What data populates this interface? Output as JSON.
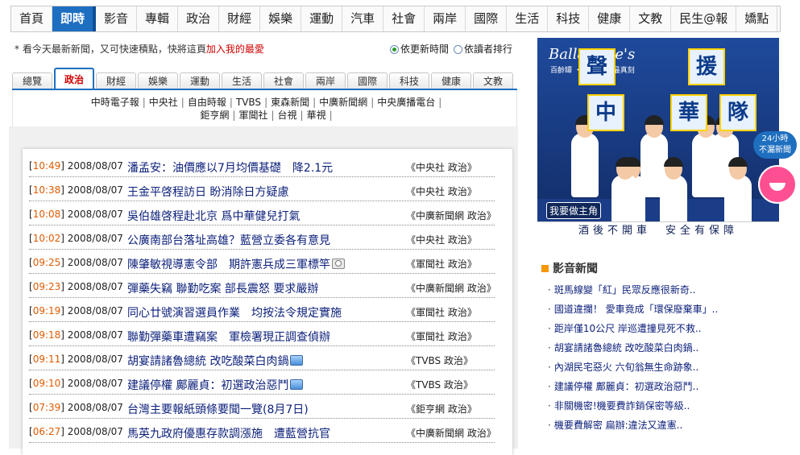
{
  "topnav": {
    "items": [
      {
        "label": "首頁"
      },
      {
        "label": "即時",
        "active": true
      },
      {
        "label": "影音"
      },
      {
        "label": "專輯"
      },
      {
        "label": "政治"
      },
      {
        "label": "財經"
      },
      {
        "label": "娛樂"
      },
      {
        "label": "運動"
      },
      {
        "label": "汽車"
      },
      {
        "label": "社會"
      },
      {
        "label": "兩岸"
      },
      {
        "label": "國際"
      },
      {
        "label": "生活"
      },
      {
        "label": "科技"
      },
      {
        "label": "健康"
      },
      {
        "label": "文教"
      },
      {
        "label": "民生@報"
      },
      {
        "label": "嬌點"
      }
    ]
  },
  "notice": {
    "prefix": "* 看今天最新新聞，又可快速積點，快將這頁",
    "link": "加入我的最愛"
  },
  "sort": {
    "option1": "依更新時間",
    "option2": "依讀者排行",
    "selected": "option1"
  },
  "cattabs": {
    "items": [
      {
        "label": "總覽"
      },
      {
        "label": "政治",
        "active": true
      },
      {
        "label": "財經"
      },
      {
        "label": "娛樂"
      },
      {
        "label": "運動"
      },
      {
        "label": "生活"
      },
      {
        "label": "社會"
      },
      {
        "label": "兩岸"
      },
      {
        "label": "國際"
      },
      {
        "label": "科技"
      },
      {
        "label": "健康"
      },
      {
        "label": "文教"
      }
    ]
  },
  "sources": {
    "line1": [
      "中時電子報",
      "中央社",
      "自由時報",
      "TVBS",
      "東森新聞",
      "中廣新聞網",
      "中央廣播電台"
    ],
    "line2": [
      "鉅亨網",
      "軍聞社",
      "台視",
      "華視"
    ]
  },
  "news": [
    {
      "time": "10:49",
      "date": "2008/08/07",
      "title": "潘孟安：油價應以7月均價基礎　降2.1元",
      "source": "《中央社 政治》",
      "icon": ""
    },
    {
      "time": "10:38",
      "date": "2008/08/07",
      "title": "王金平啓程訪日 盼消除日方疑慮",
      "source": "《中央社 政治》",
      "icon": ""
    },
    {
      "time": "10:08",
      "date": "2008/08/07",
      "title": "吳伯雄啓程赴北京 爲中華健兒打氣",
      "source": "《中廣新聞網 政治》",
      "icon": ""
    },
    {
      "time": "10:02",
      "date": "2008/08/07",
      "title": "公廣南部台落址高雄？藍營立委各有意見",
      "source": "《中央社 政治》",
      "icon": ""
    },
    {
      "time": "09:25",
      "date": "2008/08/07",
      "title": "陳肇敏視導憲令部　期許憲兵成三軍標竿",
      "source": "《軍聞社 政治》",
      "icon": "camera-icon"
    },
    {
      "time": "09:23",
      "date": "2008/08/07",
      "title": "彈藥失竊 聯勤吃案 部長震怒 要求嚴辦",
      "source": "《中廣新聞網 政治》",
      "icon": ""
    },
    {
      "time": "09:19",
      "date": "2008/08/07",
      "title": "同心廿號演習選員作業　均按法令規定實施",
      "source": "《軍聞社 政治》",
      "icon": ""
    },
    {
      "time": "09:18",
      "date": "2008/08/07",
      "title": "聯勤彈藥車遭竊案　軍檢署現正調查偵辦",
      "source": "《軍聞社 政治》",
      "icon": ""
    },
    {
      "time": "09:11",
      "date": "2008/08/07",
      "title": "胡宴請諸魯總統 改吃酸菜白肉鍋",
      "source": "《TVBS 政治》",
      "icon": "video-icon"
    },
    {
      "time": "09:10",
      "date": "2008/08/07",
      "title": "建議停權 鄺麗貞：初選政治惡鬥",
      "source": "《TVBS 政治》",
      "icon": "video-icon"
    },
    {
      "time": "07:39",
      "date": "2008/08/07",
      "title": "台灣主要報紙頭條要聞一覽(8月7日)",
      "source": "《鉅亨網 政治》",
      "icon": ""
    },
    {
      "time": "06:27",
      "date": "2008/08/07",
      "title": "馬英九政府優惠存款調漲施　遭藍營抗官",
      "source": "《中廣新聞網 政治》",
      "icon": ""
    }
  ],
  "ad": {
    "brand": "Ballantine's",
    "brand_sub": "百齡罈 ・ 國時刻・最真刻",
    "signs": [
      "聲",
      "援",
      "中",
      "華",
      "隊"
    ],
    "button": "我要做主角",
    "slogan": "酒後不開車　安全有保障"
  },
  "mascot": {
    "line1": "24小時",
    "line2": "不漏新聞"
  },
  "video_news": {
    "title": "影音新聞",
    "items": [
      "斑馬線變「紅」民眾反應很新奇..",
      "國道違攔！ 愛車竟成「環保廢棄車」..",
      "距岸僅10公尺 岸巡遭撞見死不救..",
      "胡宴請諸魯總統 改吃酸菜白肉鍋..",
      "內湖民宅惡火 六旬翁無生命跡象..",
      "建議停權 鄺麗貞：初選政治惡鬥..",
      "非關機密!機要費詐銷保密等級..",
      "機要費解密 扁辦:違法又違憲.."
    ]
  }
}
